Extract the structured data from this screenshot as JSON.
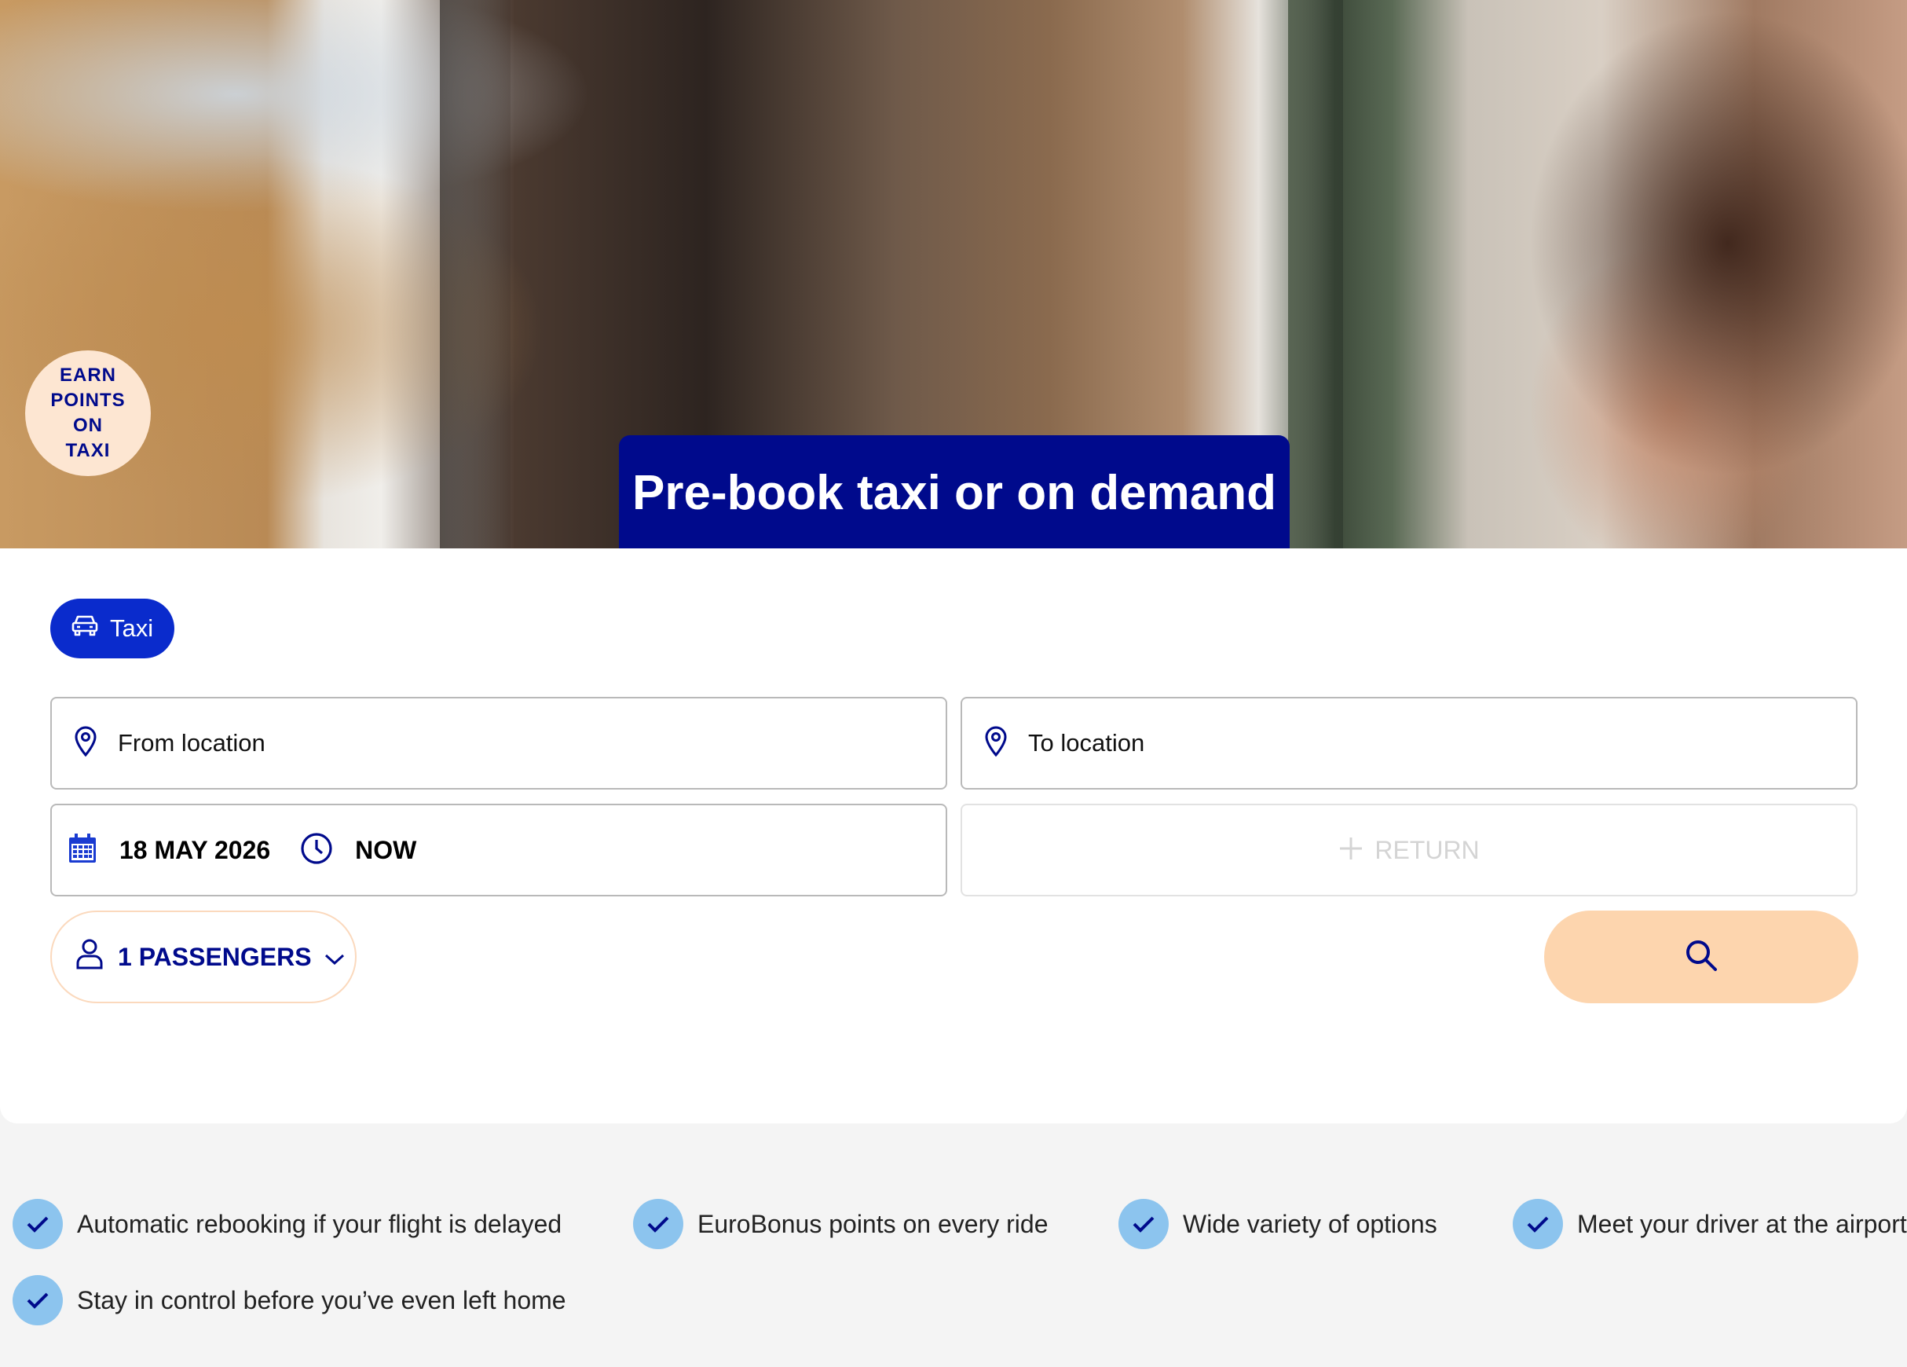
{
  "hero": {
    "badge_lines": [
      "EARN",
      "POINTS",
      "ON",
      "TAXI"
    ],
    "title": "Pre-book taxi or on demand"
  },
  "booking": {
    "tab_label": "Taxi",
    "from_placeholder": "From location",
    "to_placeholder": "To location",
    "date_value": "18 MAY 2026",
    "time_value": "NOW",
    "return_label": "RETURN",
    "passengers_label": "1 PASSENGERS"
  },
  "benefits": [
    "Automatic rebooking if your flight is delayed",
    "EuroBonus points on every ride",
    "Wide variety of options",
    "Meet your driver at the airport",
    "Stay in control before you’ve even left home"
  ],
  "colors": {
    "brand_navy": "#000a8c",
    "chip_blue": "#0a2bcc",
    "search_peach": "#fdd5ae",
    "check_blue": "#8cc4ee",
    "badge_peach": "#fde6d2"
  },
  "icons": {
    "tab": "car-icon",
    "from": "location-pin-icon",
    "to": "location-pin-icon",
    "date": "calendar-icon",
    "time": "clock-icon",
    "return": "plus-icon",
    "passengers": "user-icon",
    "dropdown": "chevron-down-icon",
    "search": "search-icon",
    "benefit": "check-icon"
  }
}
